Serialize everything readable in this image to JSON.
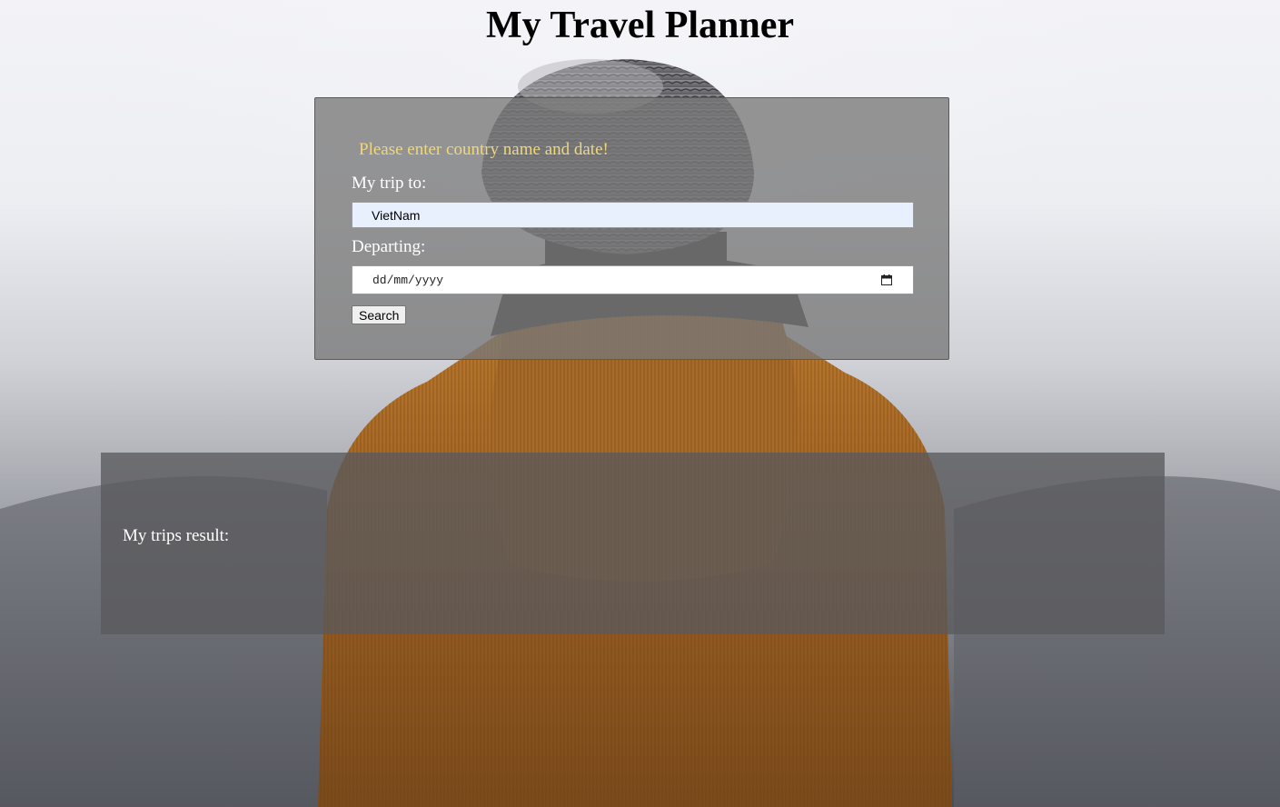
{
  "page": {
    "title": "My Travel Planner"
  },
  "form": {
    "prompt_message": "Please enter country name and date!",
    "trip_label": "My trip to:",
    "trip_value": "VietNam",
    "departing_label": "Departing:",
    "date_placeholder": "dd/mm/yyyy",
    "search_label": "Search"
  },
  "results": {
    "title": "My trips result:"
  },
  "icons": {
    "calendar": "calendar-icon"
  },
  "colors": {
    "prompt_text": "#f0d77a",
    "panel_background": "#787878",
    "input_autofill": "#e8f0fe"
  }
}
